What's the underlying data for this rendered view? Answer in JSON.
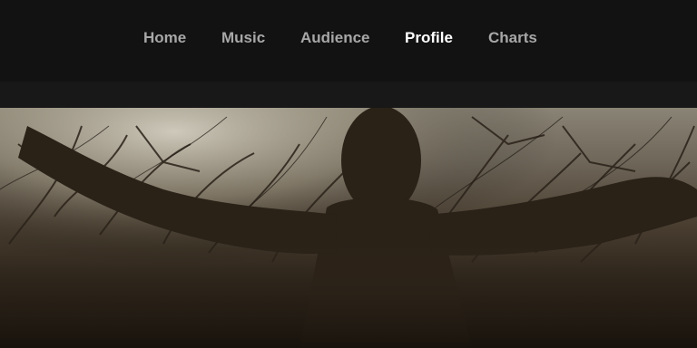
{
  "nav": {
    "items": [
      {
        "label": "Home",
        "active": false
      },
      {
        "label": "Music",
        "active": false
      },
      {
        "label": "Audience",
        "active": false
      },
      {
        "label": "Profile",
        "active": true
      },
      {
        "label": "Charts",
        "active": false
      }
    ]
  },
  "colors": {
    "background": "#121212",
    "subbar": "#181818",
    "nav_inactive": "#a7a7a7",
    "nav_active": "#ffffff"
  },
  "hero": {
    "image_description_icon": "artist-profile-photo"
  }
}
